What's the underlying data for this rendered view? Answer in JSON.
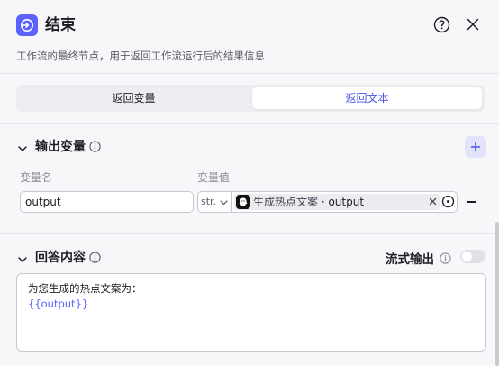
{
  "header": {
    "title": "结束",
    "description": "工作流的最终节点，用于返回工作流运行后的结果信息",
    "help_icon": "help-circle-icon",
    "close_icon": "close-icon"
  },
  "tabs": [
    {
      "label": "返回变量",
      "selected": false
    },
    {
      "label": "返回文本",
      "selected": true
    }
  ],
  "output_section": {
    "title": "输出变量",
    "columns": {
      "name": "变量名",
      "value": "变量值"
    },
    "rows": [
      {
        "name": "output",
        "type": "str.",
        "ref_node": "生成热点文案",
        "ref_sep": " · ",
        "ref_var": "output"
      }
    ]
  },
  "answer_section": {
    "title": "回答内容",
    "stream_label": "流式输出",
    "stream_enabled": false,
    "content_line1": "为您生成的热点文案为：",
    "content_line2": "{{output}}"
  },
  "colors": {
    "accent": "#5c62ff",
    "tab_active_text": "#4d53e8",
    "background": "#f7f7fa"
  }
}
